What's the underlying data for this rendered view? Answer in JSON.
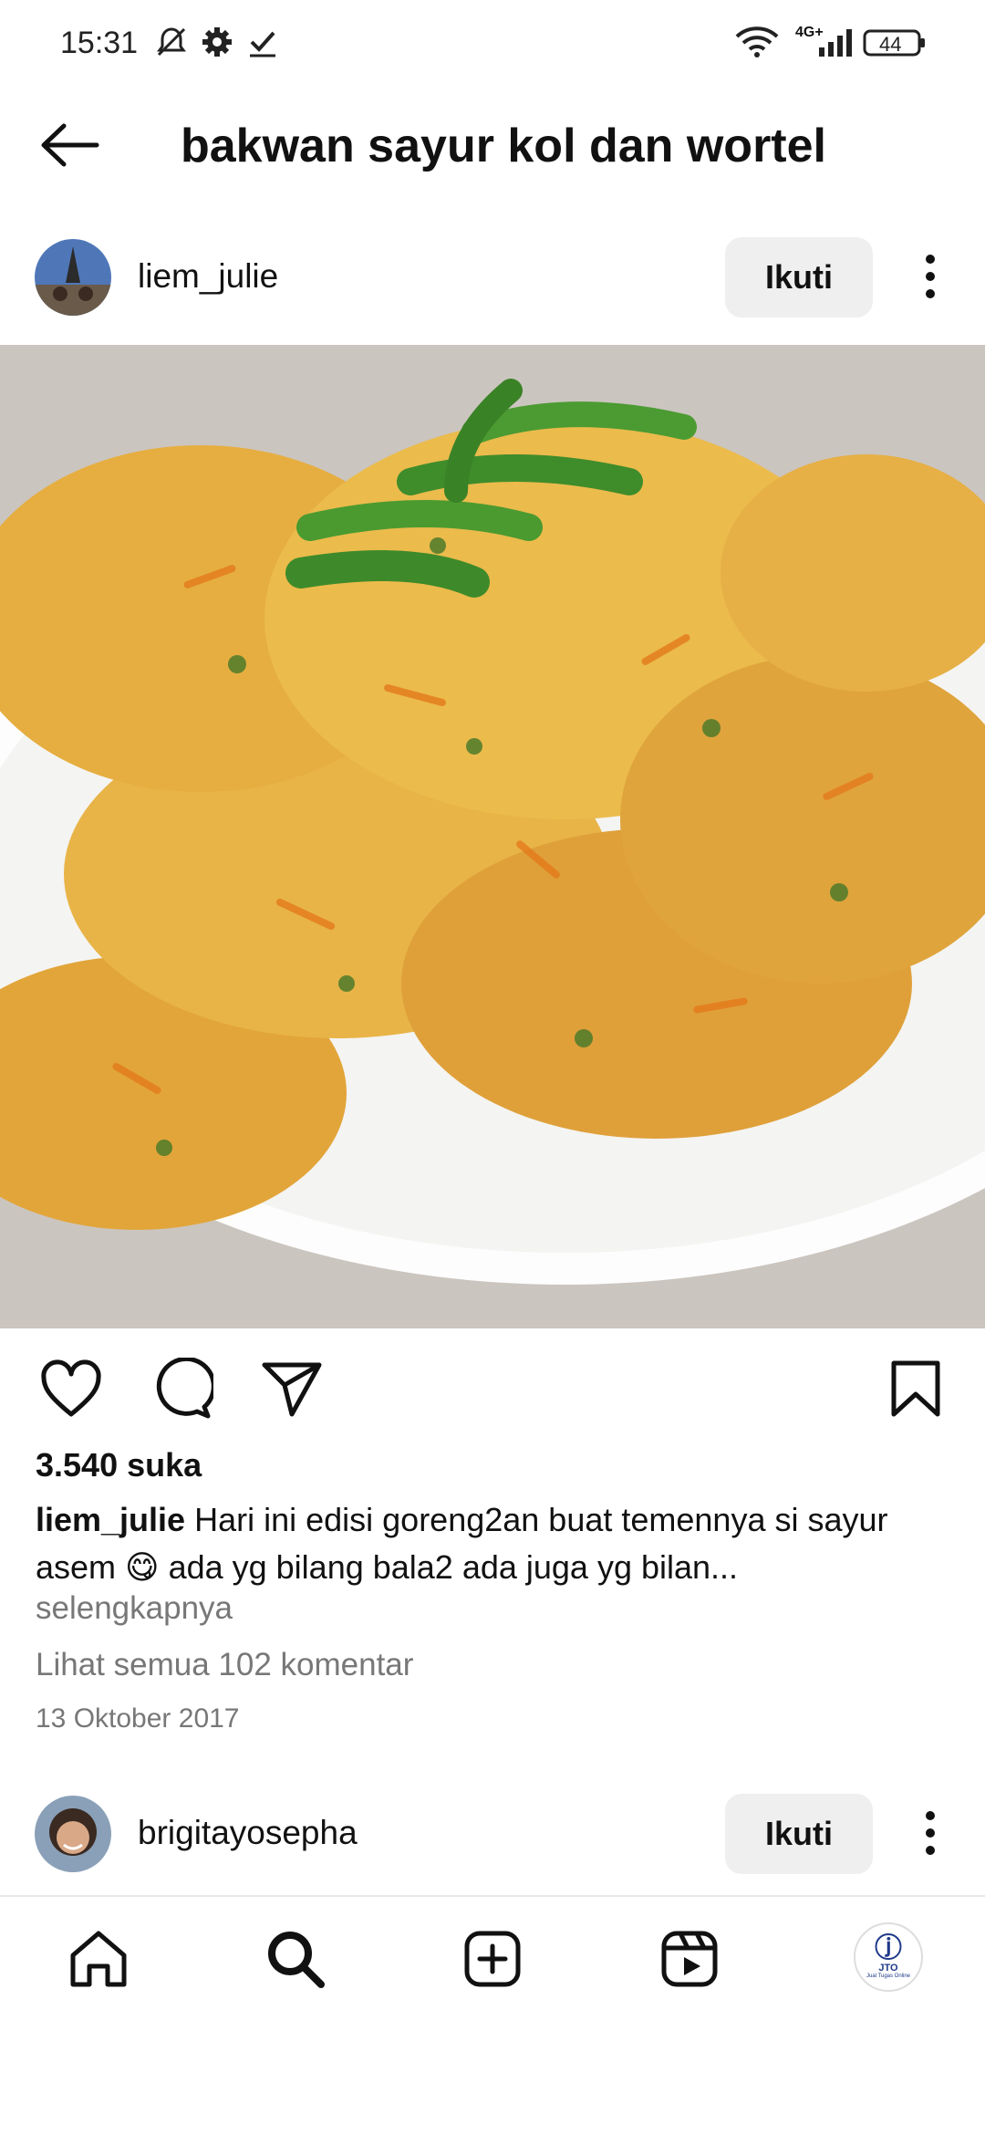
{
  "status_bar": {
    "time": "15:31",
    "battery": "44",
    "network": "4G+",
    "icons": [
      "mute-icon",
      "gear-icon",
      "check-icon",
      "wifi-icon",
      "signal-icon",
      "battery-icon"
    ]
  },
  "header": {
    "title": "bakwan sayur kol dan wortel",
    "back_icon": "back-arrow-icon"
  },
  "post": {
    "username": "liem_julie",
    "follow_label": "Ikuti",
    "likes": "3.540 suka",
    "caption_user": "liem_julie",
    "caption_text": " Hari ini edisi goreng2an buat temennya si sayur asem 😋 ada yg bilang bala2 ada juga yg bilan...",
    "more_label": "selengkapnya",
    "comments_label": "Lihat semua 102 komentar",
    "date": "13 Oktober 2017",
    "action_icons": [
      "heart-icon",
      "comment-icon",
      "share-icon",
      "bookmark-icon"
    ]
  },
  "next_post": {
    "username": "brigitayosepha",
    "follow_label": "Ikuti"
  },
  "bottom_nav": {
    "items": [
      "home-icon",
      "search-icon",
      "create-icon",
      "reels-icon",
      "profile-avatar"
    ],
    "profile_logo_abbr": "JTO",
    "profile_logo_tagline": "Jual Tugas Online"
  },
  "colors": {
    "text": "#111111",
    "secondary_text": "#777777",
    "button_bg": "#efefef",
    "photo_bg": "#c9c3bd"
  }
}
